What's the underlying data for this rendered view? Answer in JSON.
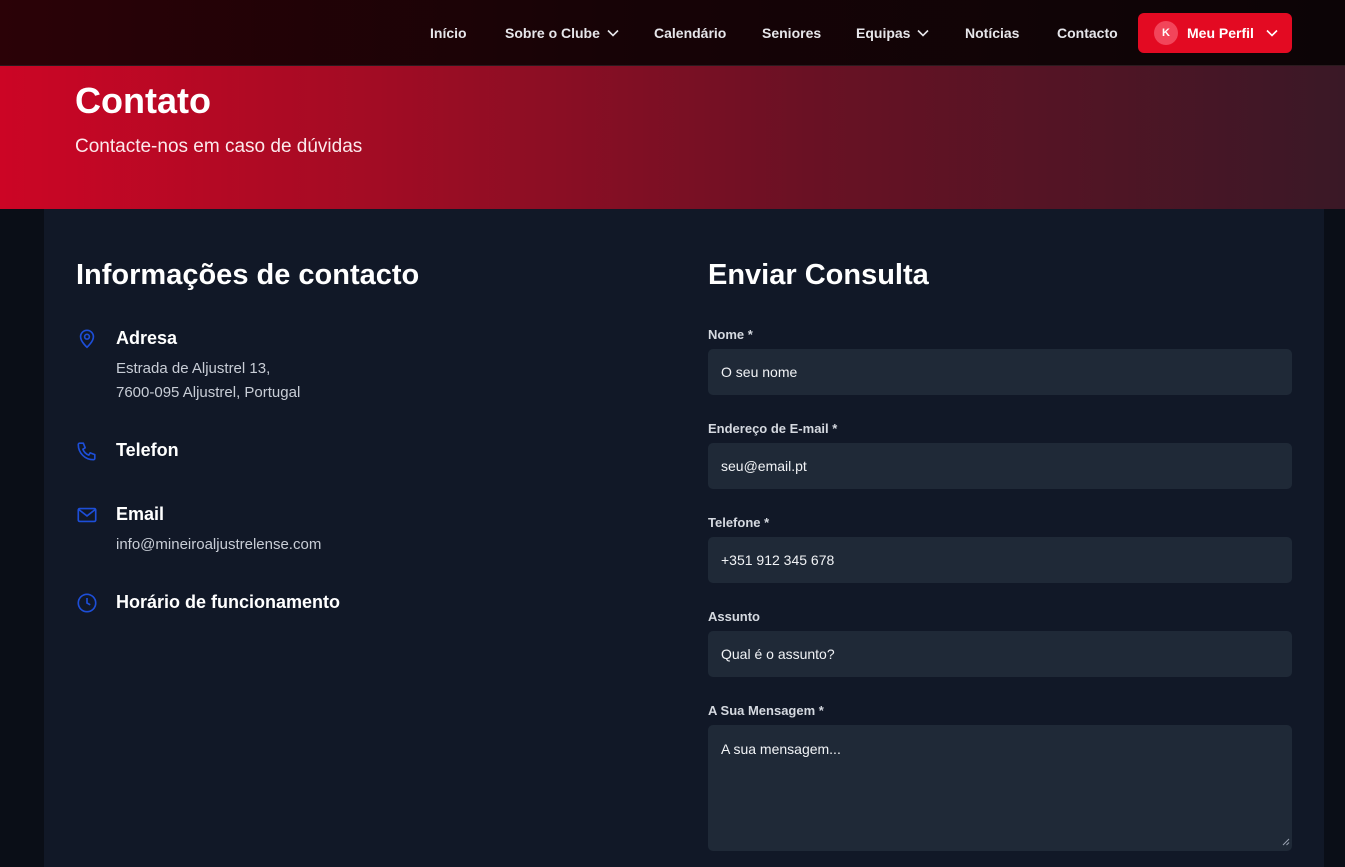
{
  "nav": {
    "items": [
      {
        "label": "Início",
        "dropdown": false
      },
      {
        "label": "Sobre o Clube",
        "dropdown": true
      },
      {
        "label": "Calendário",
        "dropdown": false
      },
      {
        "label": "Seniores",
        "dropdown": false
      },
      {
        "label": "Equipas",
        "dropdown": true
      },
      {
        "label": "Notícias",
        "dropdown": false
      },
      {
        "label": "Contacto",
        "dropdown": false
      }
    ],
    "profile": {
      "avatar_initial": "K",
      "label": "Meu Perfil"
    }
  },
  "hero": {
    "title": "Contato",
    "subtitle": "Contacte-nos em caso de dúvidas"
  },
  "info": {
    "title": "Informações de contacto",
    "address": {
      "label": "Adresa",
      "line1": "Estrada de Aljustrel 13,",
      "line2": "7600-095 Aljustrel, Portugal"
    },
    "phone": {
      "label": "Telefon"
    },
    "email": {
      "label": "Email",
      "value": "info@mineiroaljustrelense.com"
    },
    "hours": {
      "label": "Horário de funcionamento"
    }
  },
  "form": {
    "title": "Enviar Consulta",
    "name": {
      "label": "Nome *",
      "placeholder": "O seu nome"
    },
    "email": {
      "label": "Endereço de E-mail *",
      "placeholder": "seu@email.pt"
    },
    "phone": {
      "label": "Telefone *",
      "placeholder": "+351 912 345 678"
    },
    "subject": {
      "label": "Assunto",
      "placeholder": "Qual é o assunto?"
    },
    "message": {
      "label": "A Sua Mensagem *",
      "placeholder": "A sua mensagem..."
    }
  },
  "colors": {
    "accent": "#e30a22",
    "icon_blue": "#1d4ed8",
    "card_bg": "#111827",
    "input_bg": "#1f2937"
  }
}
